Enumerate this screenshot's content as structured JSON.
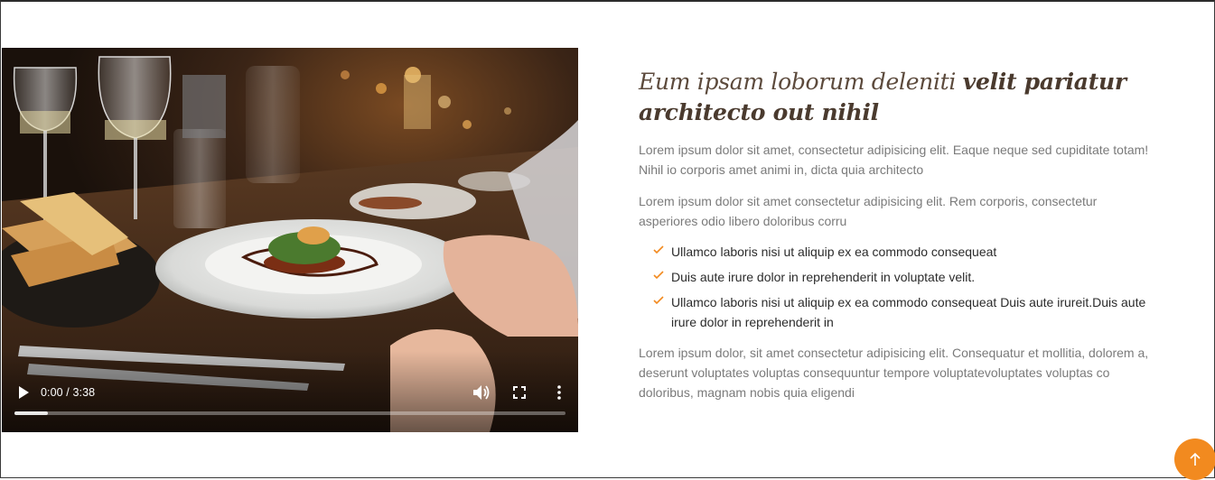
{
  "colors": {
    "accent": "#f28a1f",
    "heading": "#5c4a3c",
    "body_text": "#7a7a7a",
    "list_text": "#2b2b2b"
  },
  "video": {
    "time": "0:00 / 3:38",
    "progress_fraction": 0.06,
    "icons": [
      "play-icon",
      "volume-icon",
      "fullscreen-icon",
      "more-options-icon"
    ]
  },
  "about": {
    "heading_light": "Eum ipsam loborum deleniti ",
    "heading_strong": "velit pariatur architecto out nihil",
    "paragraph_1": "Lorem ipsum dolor sit amet, consectetur adipisicing elit. Eaque neque sed cupiditate totam! Nihil io corporis amet animi in, dicta quia architecto",
    "paragraph_2": "Lorem ipsum dolor sit amet consectetur adipisicing elit. Rem corporis, consectetur asperiores odio libero doloribus corru",
    "list": [
      "Ullamco laboris nisi ut aliquip ex ea commodo consequeat",
      "Duis aute irure dolor in reprehenderit in voluptate velit.",
      "Ullamco laboris nisi ut aliquip ex ea commodo consequeat Duis aute irureit.Duis aute irure dolor in reprehenderit in"
    ],
    "paragraph_3": "Lorem ipsum dolor, sit amet consectetur adipisicing elit. Consequatur et mollitia, dolorem a, deserunt voluptates voluptas consequuntur tempore voluptatevoluptates voluptas co doloribus, magnam nobis quia eligendi"
  },
  "back_to_top": {
    "icon": "arrow-up-icon"
  }
}
